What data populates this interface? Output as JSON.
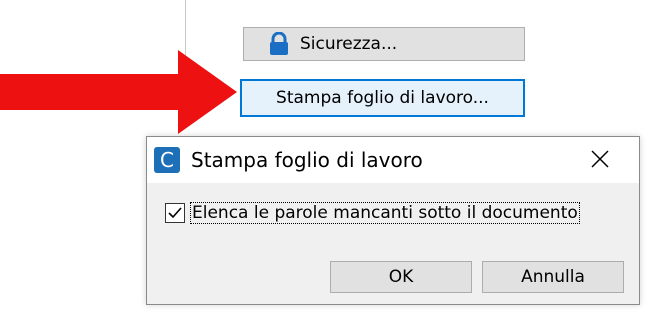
{
  "toolbar": {
    "security_label": "Sicurezza...",
    "print_label": "Stampa foglio di lavoro..."
  },
  "dialog": {
    "app_icon_letter": "C",
    "title": "Stampa foglio di lavoro",
    "checkbox_label": "Elenca le parole mancanti sotto il documento",
    "checkbox_checked": true,
    "ok_label": "OK",
    "cancel_label": "Annulla"
  },
  "icons": {
    "security": "lock-icon",
    "close": "close-icon",
    "pointer": "red-arrow-icon"
  },
  "colors": {
    "arrow": "#ee1111",
    "lock": "#1a6fc4",
    "focus_border": "#0078d7",
    "focus_fill": "#e5f1fb",
    "app_icon": "#1d6fb8"
  }
}
